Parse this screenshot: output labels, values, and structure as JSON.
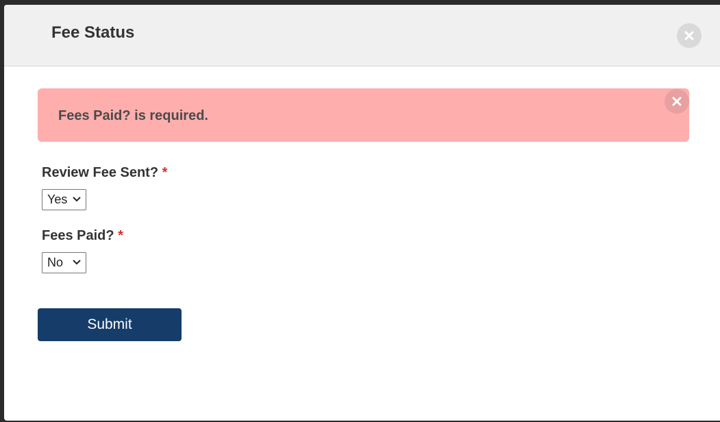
{
  "modal": {
    "title": "Fee Status",
    "close_icon": "close-icon"
  },
  "alert": {
    "message": "Fees Paid? is required.",
    "close_icon": "close-icon",
    "background_color": "#ffaeae"
  },
  "form": {
    "fields": [
      {
        "label": "Review Fee Sent?",
        "required_mark": "*",
        "selected_value": "Yes"
      },
      {
        "label": "Fees Paid?",
        "required_mark": "*",
        "selected_value": "No"
      }
    ],
    "submit_label": "Submit",
    "submit_color": "#163c69"
  }
}
